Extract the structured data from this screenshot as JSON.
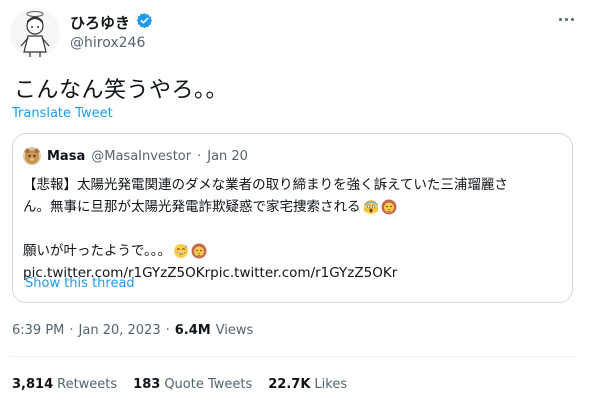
{
  "author": {
    "display_name": "ひろゆき",
    "handle": "@hirox246",
    "verified": true
  },
  "tweet": {
    "text": "こんなん笑うやろ。。",
    "translate_label": "Translate Tweet"
  },
  "quote": {
    "name": "Masa",
    "handle": "@MasaInvestor",
    "separator": "·",
    "date": "Jan 20",
    "line1": "【悲報】太陽光発電関連のダメな業者の取り締まりを強く訴えていた三浦瑠麗さ",
    "line2": "ん。無事に旦那が太陽光発電詐欺疑惑で家宅捜索される",
    "line3": "願いが叶ったようで。。。",
    "link": "pic.twitter.com/r1GYzZ5OKrpic.twitter.com/r1GYzZ5OKr",
    "show_thread": "Show this thread"
  },
  "meta": {
    "time": "6:39 PM",
    "separator1": "·",
    "date": "Jan 20, 2023",
    "separator2": "·",
    "views_count": "6.4M",
    "views_label": "Views"
  },
  "stats": {
    "retweets_count": "3,814",
    "retweets_label": "Retweets",
    "quotes_count": "183",
    "quotes_label": "Quote Tweets",
    "likes_count": "22.7K",
    "likes_label": "Likes"
  },
  "colors": {
    "accent": "#1d9bf0",
    "secondary_text": "#536471",
    "border": "#cfd9de"
  }
}
